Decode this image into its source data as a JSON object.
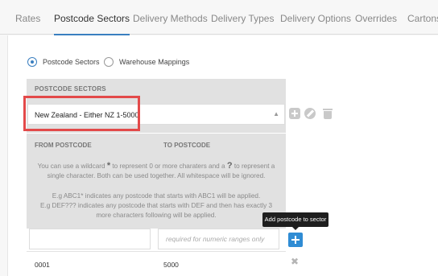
{
  "tabs": [
    {
      "label": "Rates",
      "active": false
    },
    {
      "label": "Postcode Sectors",
      "active": true
    },
    {
      "label": "Delivery Methods",
      "active": false
    },
    {
      "label": "Delivery Types",
      "active": false
    },
    {
      "label": "Delivery Options",
      "active": false
    },
    {
      "label": "Overrides",
      "active": false
    },
    {
      "label": "Cartons",
      "active": false
    }
  ],
  "mode": {
    "options": [
      {
        "label": "Postcode Sectors",
        "checked": true
      },
      {
        "label": "Warehouse Mappings",
        "checked": false
      }
    ]
  },
  "sectors": {
    "heading": "POSTCODE SECTORS",
    "selected": "New Zealand - Either NZ 1-5000",
    "icons": [
      "plus-icon",
      "pencil-icon",
      "trash-icon"
    ]
  },
  "postcodes": {
    "from_heading": "FROM POSTCODE",
    "to_heading": "TO POSTCODE",
    "info_line1_a": "You can use a wildcard",
    "info_star": "*",
    "info_line1_b": "to represent 0 or more charaters and a",
    "info_q": "?",
    "info_line1_c": "to represent a",
    "info_line2": "single character. Both can be used together. All whitespace will be ignored.",
    "example1": "E.g ABC1* indicates any postcode that starts with ABC1 will be applied.",
    "example2": "E.g DEF??? indicates any postcode that starts with DEF and then has exactly 3",
    "example3": "more characters following will be applied.",
    "from_value": "",
    "to_placeholder": "required for numeric ranges only",
    "add_tooltip": "Add postcode to sector",
    "rows": [
      {
        "from": "0001",
        "to": "5000"
      }
    ]
  },
  "colors": {
    "accent": "#3a7fc0",
    "add_button": "#2f8cd4",
    "highlight": "#e34a4a"
  }
}
